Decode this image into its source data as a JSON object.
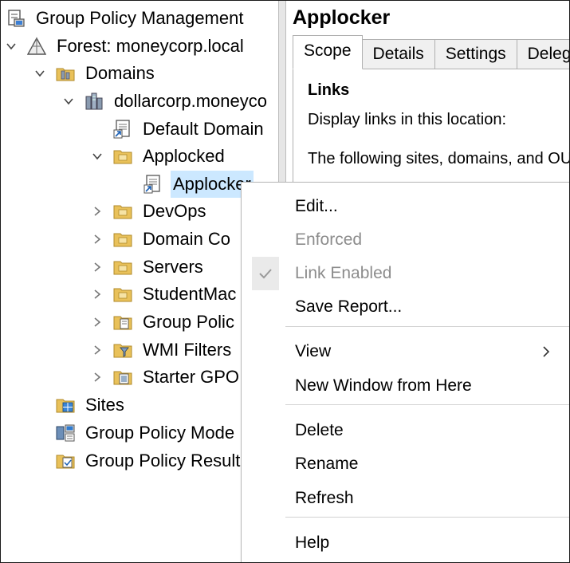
{
  "tree": {
    "root": "Group Policy Management",
    "forest": "Forest: moneycorp.local",
    "domains": "Domains",
    "domain": "dollarcorp.moneyco",
    "default_domain": "Default Domain",
    "applocked": "Applocked",
    "applocker": "Applocker",
    "devops": "DevOps",
    "domain_controllers": "Domain Co",
    "servers": "Servers",
    "student_machines": "StudentMac",
    "group_policy_objects": "Group Polic",
    "wmi_filters": "WMI Filters",
    "starter_gpos": "Starter GPO",
    "sites": "Sites",
    "gp_modeling": "Group Policy Mode",
    "gp_results": "Group Policy Result"
  },
  "pane": {
    "title": "Applocker",
    "tabs": [
      "Scope",
      "Details",
      "Settings",
      "Delega"
    ],
    "active_tab": "Scope",
    "links_heading": "Links",
    "display_links": "Display links in this location:",
    "following_text": "The following sites, domains, and OU"
  },
  "menu": {
    "edit": "Edit...",
    "enforced": "Enforced",
    "link_enabled": "Link Enabled",
    "save_report": "Save Report...",
    "view": "View",
    "new_window": "New Window from Here",
    "delete": "Delete",
    "rename": "Rename",
    "refresh": "Refresh",
    "help": "Help"
  },
  "colors": {
    "selection": "#cce8ff",
    "disabled_text": "#8c8c8c",
    "folder": "#e9c15a"
  }
}
